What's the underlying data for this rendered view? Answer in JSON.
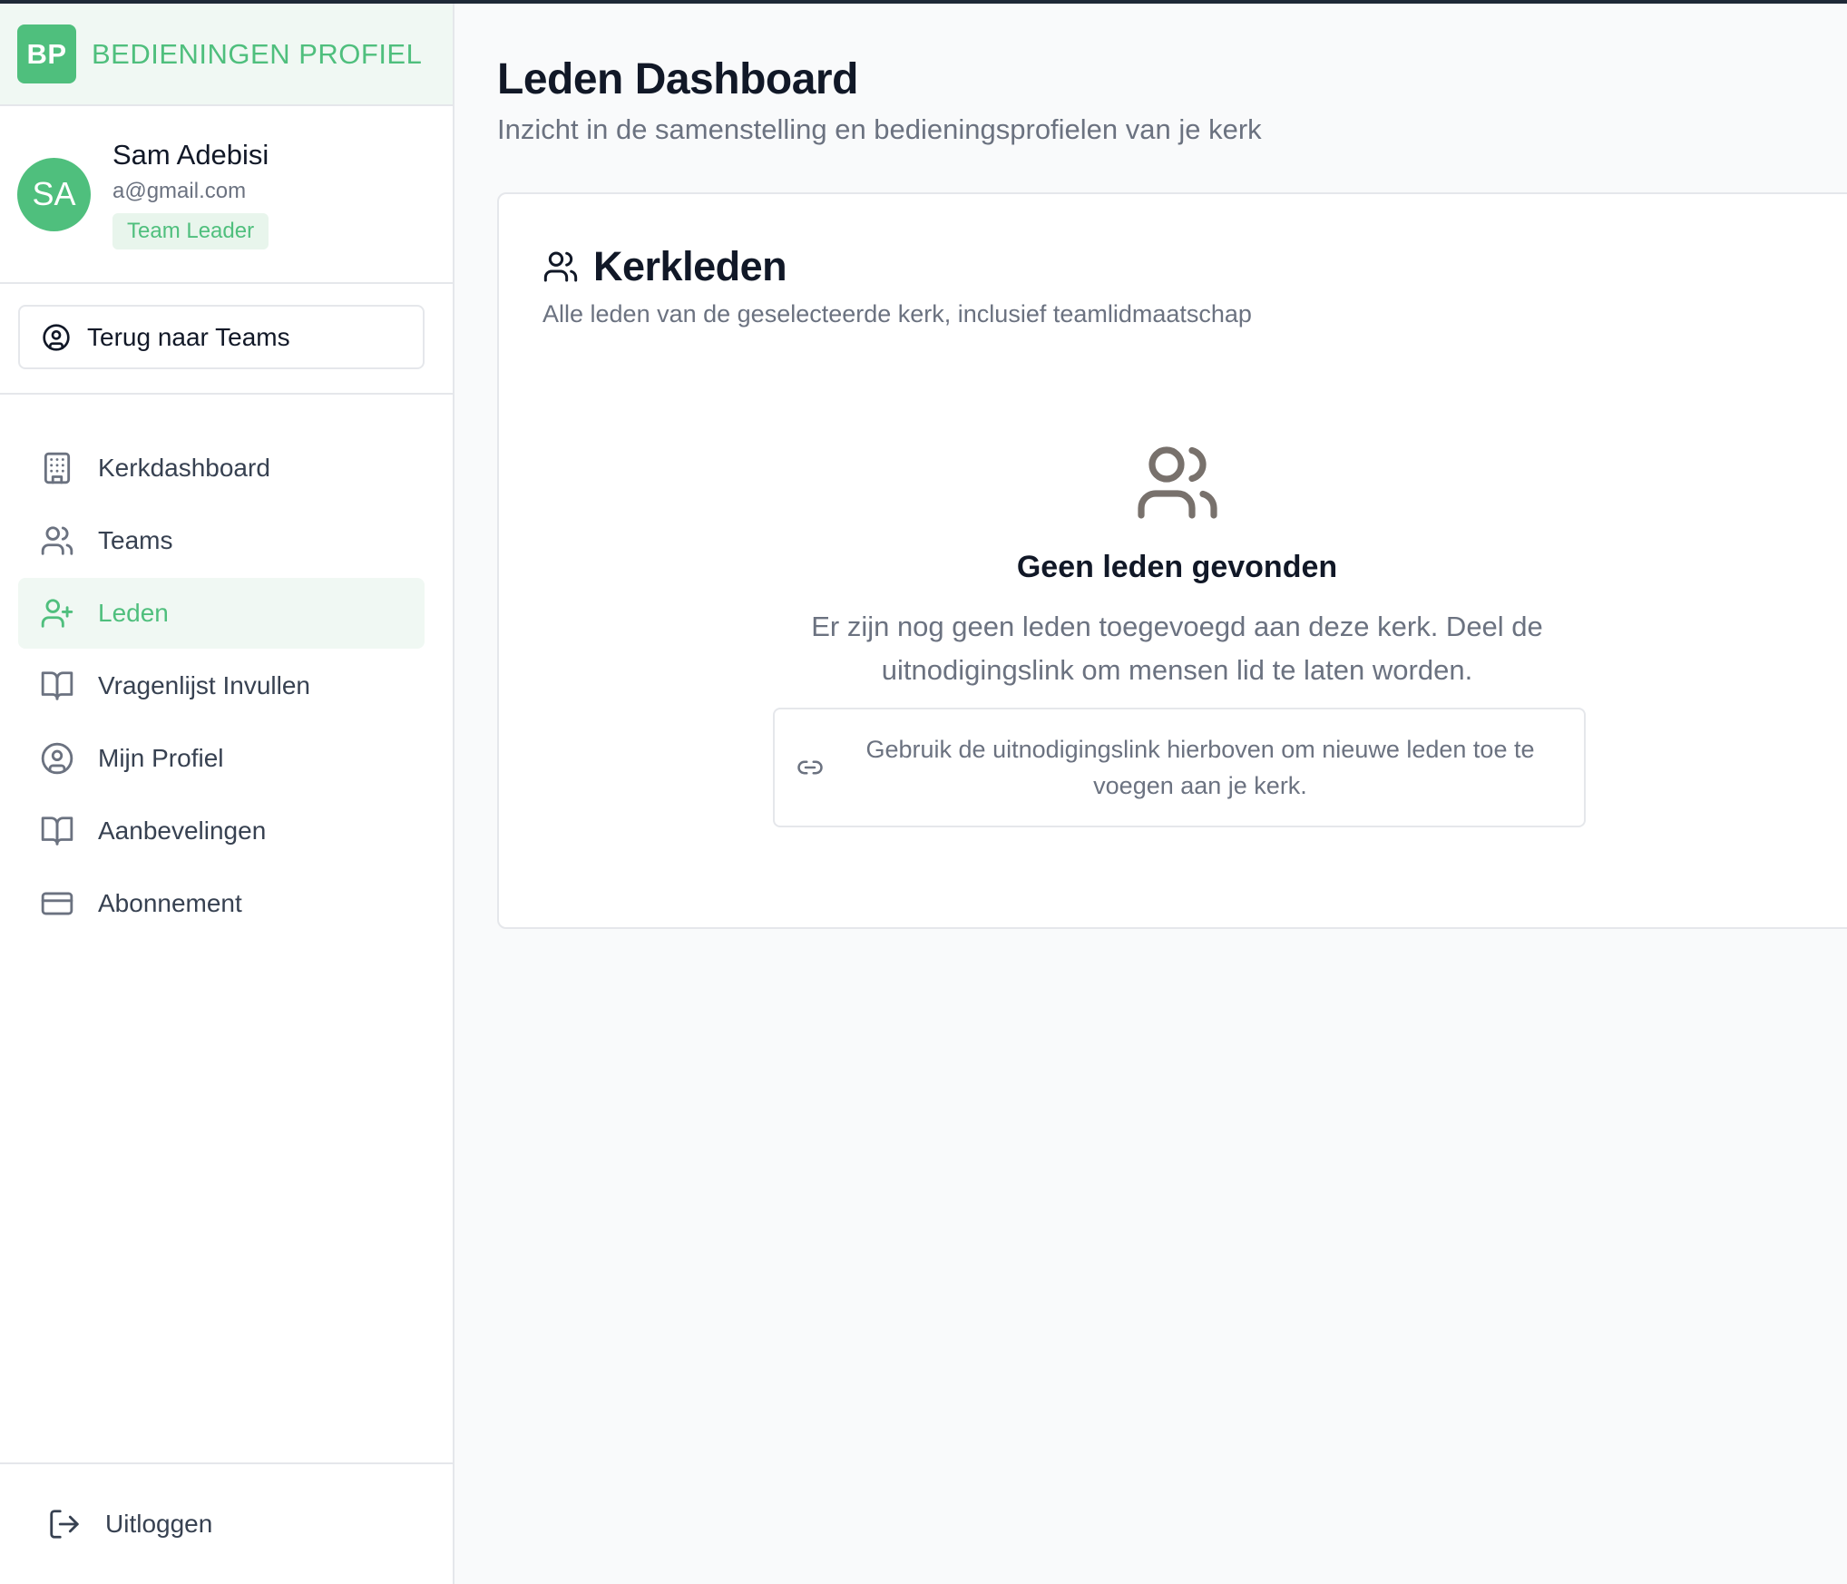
{
  "brand": {
    "logo": "BP",
    "name": "BEDIENINGEN PROFIEL",
    "accent": "#4fbf7d"
  },
  "user": {
    "initials": "SA",
    "name": "Sam Adebisi",
    "email": "a@gmail.com",
    "role": "Team Leader"
  },
  "back_button": {
    "label": "Terug naar Teams",
    "icon": "user-circle-icon"
  },
  "nav": [
    {
      "label": "Kerkdashboard",
      "icon": "building-icon",
      "active": false
    },
    {
      "label": "Teams",
      "icon": "users-icon",
      "active": false
    },
    {
      "label": "Leden",
      "icon": "user-plus-icon",
      "active": true
    },
    {
      "label": "Vragenlijst Invullen",
      "icon": "book-open-icon",
      "active": false
    },
    {
      "label": "Mijn Profiel",
      "icon": "user-circle-icon",
      "active": false
    },
    {
      "label": "Aanbevelingen",
      "icon": "book-open-icon",
      "active": false
    },
    {
      "label": "Abonnement",
      "icon": "credit-card-icon",
      "active": false
    }
  ],
  "logout": {
    "label": "Uitloggen",
    "icon": "logout-icon"
  },
  "page": {
    "title": "Leden Dashboard",
    "subtitle": "Inzicht in de samenstelling en bedieningsprofielen van je kerk"
  },
  "card": {
    "title": "Kerkleden",
    "subtitle": "Alle leden van de geselecteerde kerk, inclusief teamlidmaatschap",
    "empty_title": "Geen leden gevonden",
    "empty_text": "Er zijn nog geen leden toegevoegd aan deze kerk. Deel de uitnodigingslink om mensen lid te laten worden.",
    "hint": "Gebruik de uitnodigingslink hierboven om nieuwe leden toe te voegen aan je kerk."
  }
}
